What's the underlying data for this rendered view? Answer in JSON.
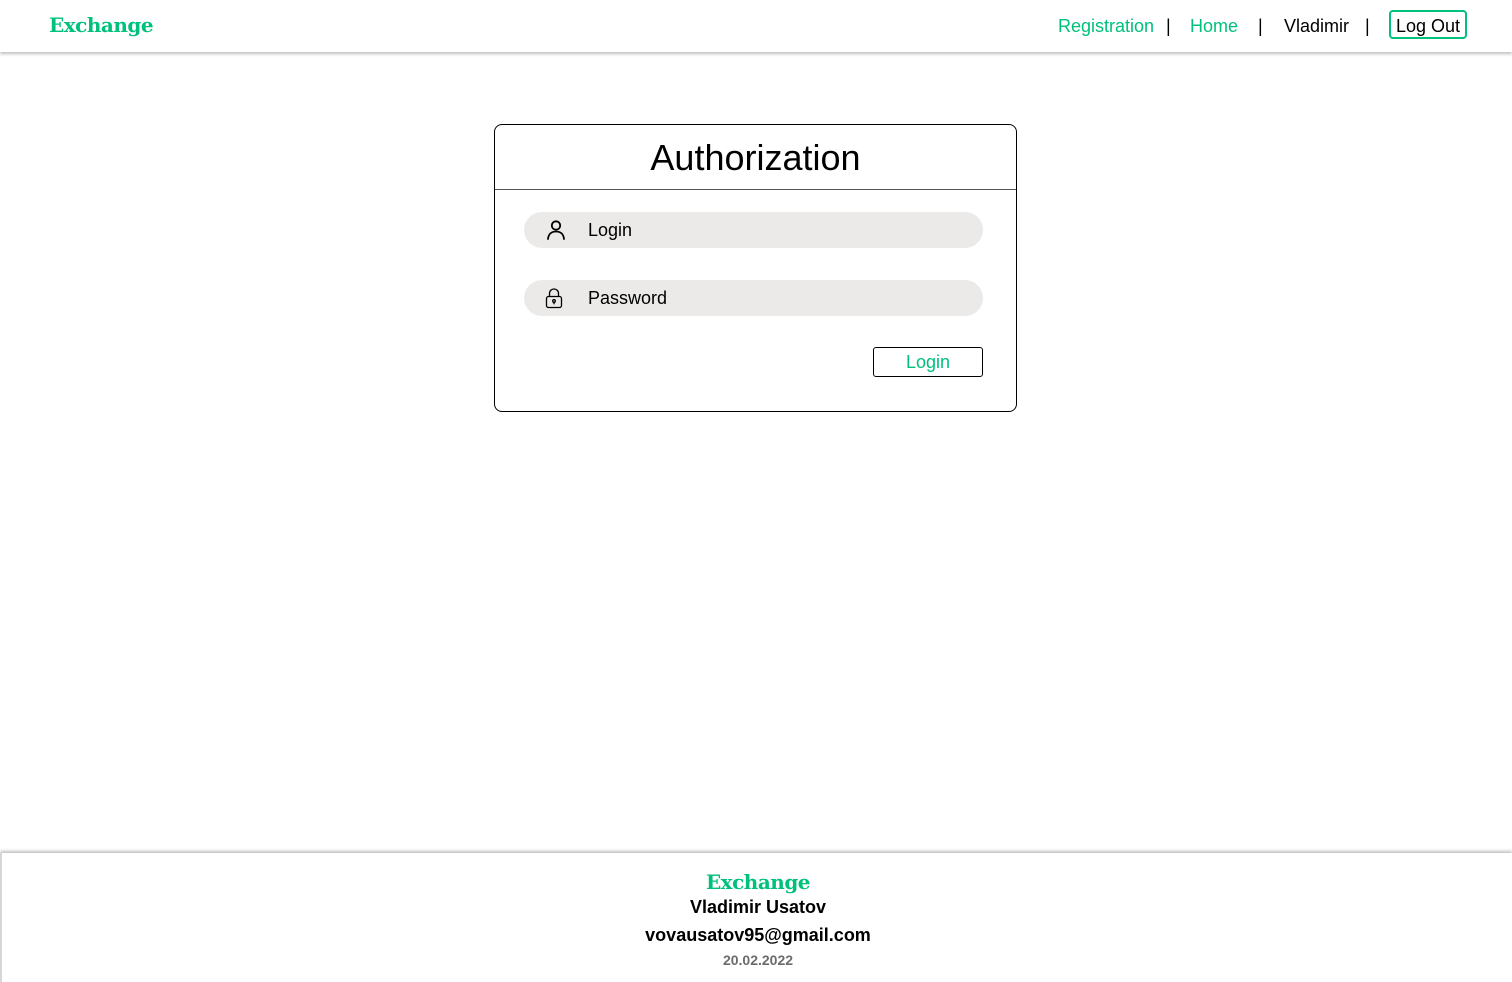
{
  "header": {
    "logo": "Exchange",
    "nav": {
      "registration": "Registration",
      "separator": "|",
      "home": "Home",
      "username": "Vladimir",
      "logout": "Log Out"
    }
  },
  "auth": {
    "title": "Authorization",
    "login_placeholder": "Login",
    "password_placeholder": "Password",
    "submit_label": "Login",
    "login_icon": "user-icon",
    "password_icon": "lock-icon"
  },
  "footer": {
    "logo": "Exchange",
    "name": "Vladimir Usatov",
    "email": "vovausatov95@gmail.com",
    "date": "20.02.2022"
  },
  "colors": {
    "accent": "#00c17c",
    "field_background": "#ebeae8",
    "text": "#000000",
    "muted": "#6b6b6b"
  }
}
